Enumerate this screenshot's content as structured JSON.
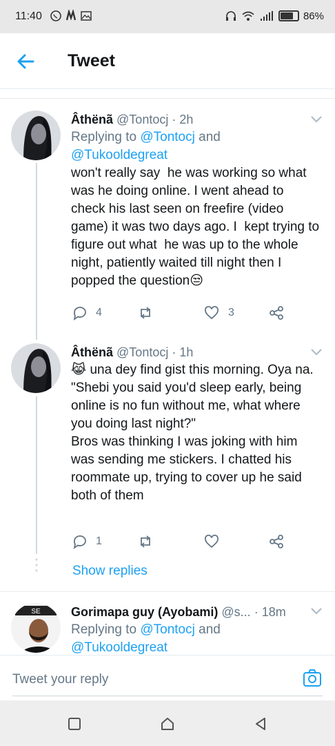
{
  "status_bar": {
    "time": "11:40",
    "battery": "86%"
  },
  "header": {
    "title": "Tweet"
  },
  "tweets": [
    {
      "name": "Âthënã",
      "handle": "@Tontocj",
      "dot": "·",
      "time": "2h",
      "replying_prefix": "Replying to",
      "replying_1": "@Tontocj",
      "replying_and": "and",
      "replying_2": "@Tukooldegreat",
      "text": "won't really say  he was working so what was he doing online. I went ahead to check his last seen on freefire (video game) it was two days ago. I  kept trying to figure out what  he was up to the whole night, patiently waited till night then I popped the question😒",
      "replies": "4",
      "retweets": "",
      "likes": "3"
    },
    {
      "name": "Âthënã",
      "handle": "@Tontocj",
      "dot": "·",
      "time": "1h",
      "text": "😹 una dey find gist this morning. Oya na.\n\"Shebi you said you'd sleep early, being online is no fun without me, what where you doing last night?\"\nBros was thinking I was joking with him was sending me stickers. I chatted his roommate up, trying to cover up he said both of them",
      "replies": "1",
      "retweets": "",
      "likes": ""
    },
    {
      "name": "Gorimapa guy (Ayobami)",
      "handle": "@s...",
      "dot": "·",
      "time": "18m",
      "replying_prefix": "Replying to",
      "replying_1": "@Tontocj",
      "replying_and": "and",
      "replying_2": "@Tukooldegreat"
    }
  ],
  "show_replies": "Show replies",
  "reply_bar": {
    "placeholder": "Tweet your reply"
  },
  "colors": {
    "accent": "#1da1f2",
    "muted": "#657786",
    "text": "#14171a"
  }
}
